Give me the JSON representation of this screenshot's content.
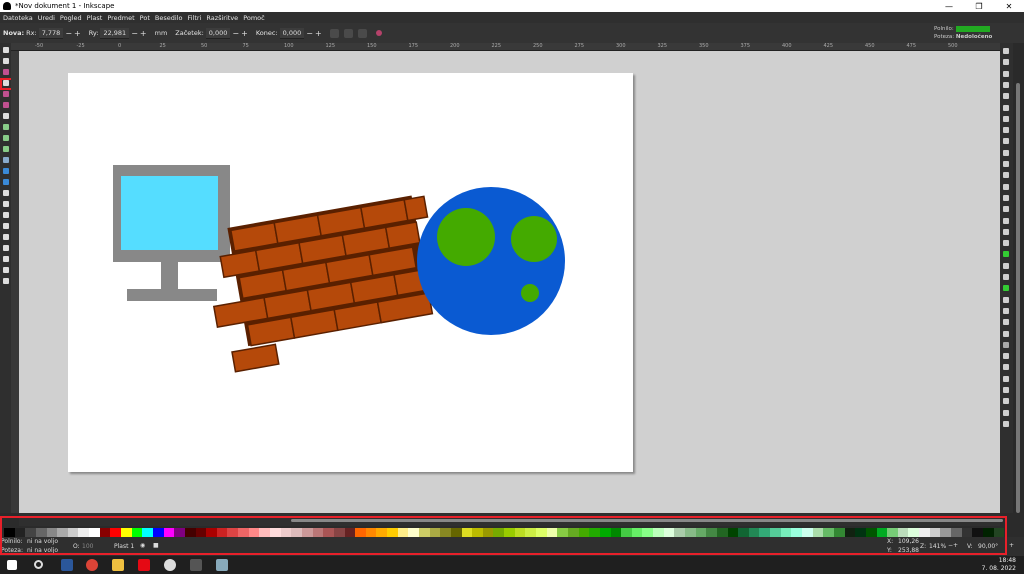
{
  "window": {
    "title": "*Nov dokument 1 - Inkscape",
    "minimize": "—",
    "restore": "❐",
    "close": "✕"
  },
  "menu": [
    "Datoteka",
    "Uredi",
    "Pogled",
    "Plast",
    "Predmet",
    "Pot",
    "Besedilo",
    "Filtri",
    "Razširitve",
    "Pomoč"
  ],
  "tool_controls": {
    "new_label": "Nova:",
    "rx_label": "Rx:",
    "rx_value": "7,778",
    "ry_label": "Ry:",
    "ry_value": "22,981",
    "unit": "mm",
    "start_label": "Začetek:",
    "start_value": "0,000",
    "end_label": "Konec:",
    "end_value": "0,000",
    "plusminus": "−+"
  },
  "style_indicator": {
    "fill_label": "Polnilo:",
    "stroke_label": "Poteza:",
    "stroke_value": "Nedoločeno",
    "fill_color": "#22aa22"
  },
  "ruler_labels": [
    "-50",
    "-25",
    "0",
    "25",
    "50",
    "75",
    "100",
    "125",
    "150",
    "175",
    "200",
    "225",
    "250",
    "275",
    "300",
    "325",
    "350",
    "375",
    "400",
    "425",
    "450",
    "475",
    "500"
  ],
  "drawing": {
    "monitor_frame_color": "#888888",
    "monitor_screen_color": "#55ddff",
    "brick_color": "#b5490a",
    "mortar_color": "#5a2000",
    "globe_color": "#0a5ad2",
    "land_color": "#44aa00"
  },
  "status": {
    "fill_label": "Polnilo:",
    "fill_value": "ni na voljo",
    "stroke_label": "Poteza:",
    "stroke_value": "ni na voljo",
    "opacity_label": "O:",
    "opacity_value": "100",
    "layer": "Plast 1",
    "x_label": "X:",
    "x_value": "109,26",
    "y_label": "Y:",
    "y_value": "253,88",
    "zoom_label": "Z:",
    "zoom_value": "141%",
    "rotation_label": "V:",
    "rotation_value": "90,00°"
  },
  "taskbar": {
    "time": "18:48",
    "date": "7. 08. 2022"
  },
  "accent": "#e8202a"
}
